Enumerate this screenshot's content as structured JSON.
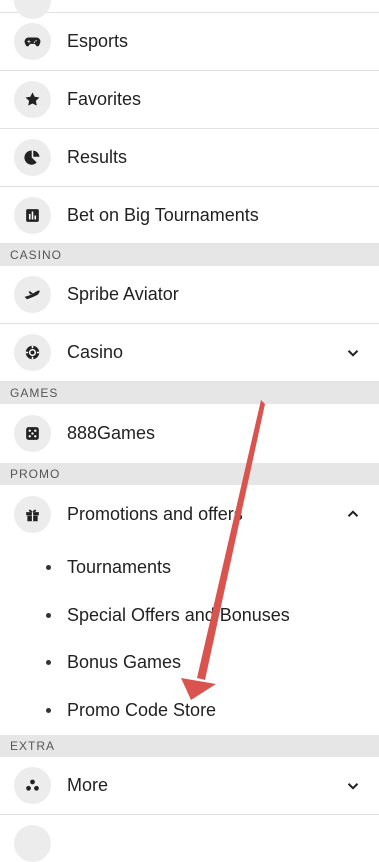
{
  "menu": {
    "top_items": [
      {
        "label": "Esports",
        "icon": "gamepad-icon"
      },
      {
        "label": "Favorites",
        "icon": "star-icon"
      },
      {
        "label": "Results",
        "icon": "pie-chart-icon"
      },
      {
        "label": "Bet on Big Tournaments",
        "icon": "bar-chart-icon"
      }
    ],
    "casino_section": "CASINO",
    "casino_items": [
      {
        "label": "Spribe Aviator",
        "icon": "airplane-icon"
      },
      {
        "label": "Casino",
        "icon": "casino-chip-icon"
      }
    ],
    "games_section": "GAMES",
    "games_items": [
      {
        "label": "888Games",
        "icon": "dice-icon"
      }
    ],
    "promo_section": "PROMO",
    "promo_item": {
      "label": "Promotions and offers",
      "icon": "gift-icon"
    },
    "promo_subitems": [
      "Tournaments",
      "Special Offers and Bonuses",
      "Bonus Games",
      "Promo Code Store"
    ],
    "extra_section": "EXTRA",
    "extra_items": [
      {
        "label": "More",
        "icon": "more-dots-icon"
      }
    ]
  },
  "colors": {
    "annotation_arrow": "#d9534f",
    "section_bg": "#e6e6e6",
    "icon_bg": "#ececec"
  }
}
